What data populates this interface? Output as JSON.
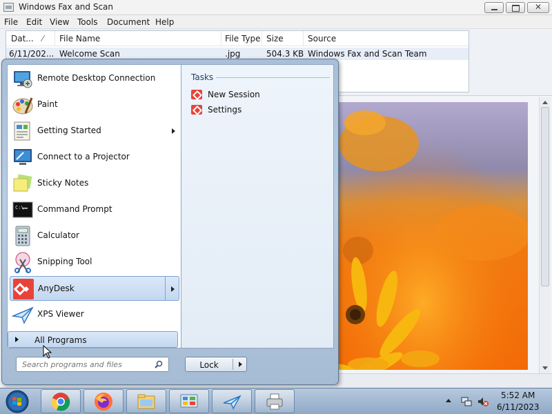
{
  "window": {
    "title": "Windows Fax and Scan",
    "menu": [
      "File",
      "Edit",
      "View",
      "Tools",
      "Document",
      "Help"
    ]
  },
  "listview": {
    "columns": [
      "Dat...",
      "File Name",
      "File Type",
      "Size",
      "Source"
    ],
    "rows": [
      {
        "date": "6/11/202...",
        "name": "Welcome Scan",
        "type": ".jpg",
        "size": "504.3 KB",
        "source": "Windows Fax and Scan Team"
      }
    ]
  },
  "start_menu": {
    "programs": [
      {
        "label": "Remote Desktop Connection",
        "icon": "remote-desktop-icon"
      },
      {
        "label": "Paint",
        "icon": "paint-icon"
      },
      {
        "label": "Getting Started",
        "icon": "getting-started-icon",
        "submenu": true
      },
      {
        "label": "Connect to a Projector",
        "icon": "projector-icon"
      },
      {
        "label": "Sticky Notes",
        "icon": "sticky-notes-icon"
      },
      {
        "label": "Command Prompt",
        "icon": "command-prompt-icon"
      },
      {
        "label": "Calculator",
        "icon": "calculator-icon"
      },
      {
        "label": "Snipping Tool",
        "icon": "snipping-tool-icon"
      },
      {
        "label": "AnyDesk",
        "icon": "anydesk-icon",
        "submenu": true,
        "highlighted": true
      },
      {
        "label": "XPS Viewer",
        "icon": "xps-viewer-icon"
      }
    ],
    "all_programs": "All Programs",
    "search_placeholder": "Search programs and files",
    "lock_label": "Lock",
    "tasks": {
      "title": "Tasks",
      "items": [
        "New Session",
        "Settings"
      ]
    }
  },
  "taskbar": {
    "pinned": [
      "chrome-icon",
      "firefox-icon",
      "explorer-icon",
      "control-panel-icon",
      "fax-and-scan-icon",
      "printer-icon"
    ],
    "time": "5:52 AM",
    "date": "6/11/2023"
  },
  "colors": {
    "anydesk": "#e8433a",
    "highlight": "#c2d7f0",
    "taskbar": "#a6bdd6"
  }
}
